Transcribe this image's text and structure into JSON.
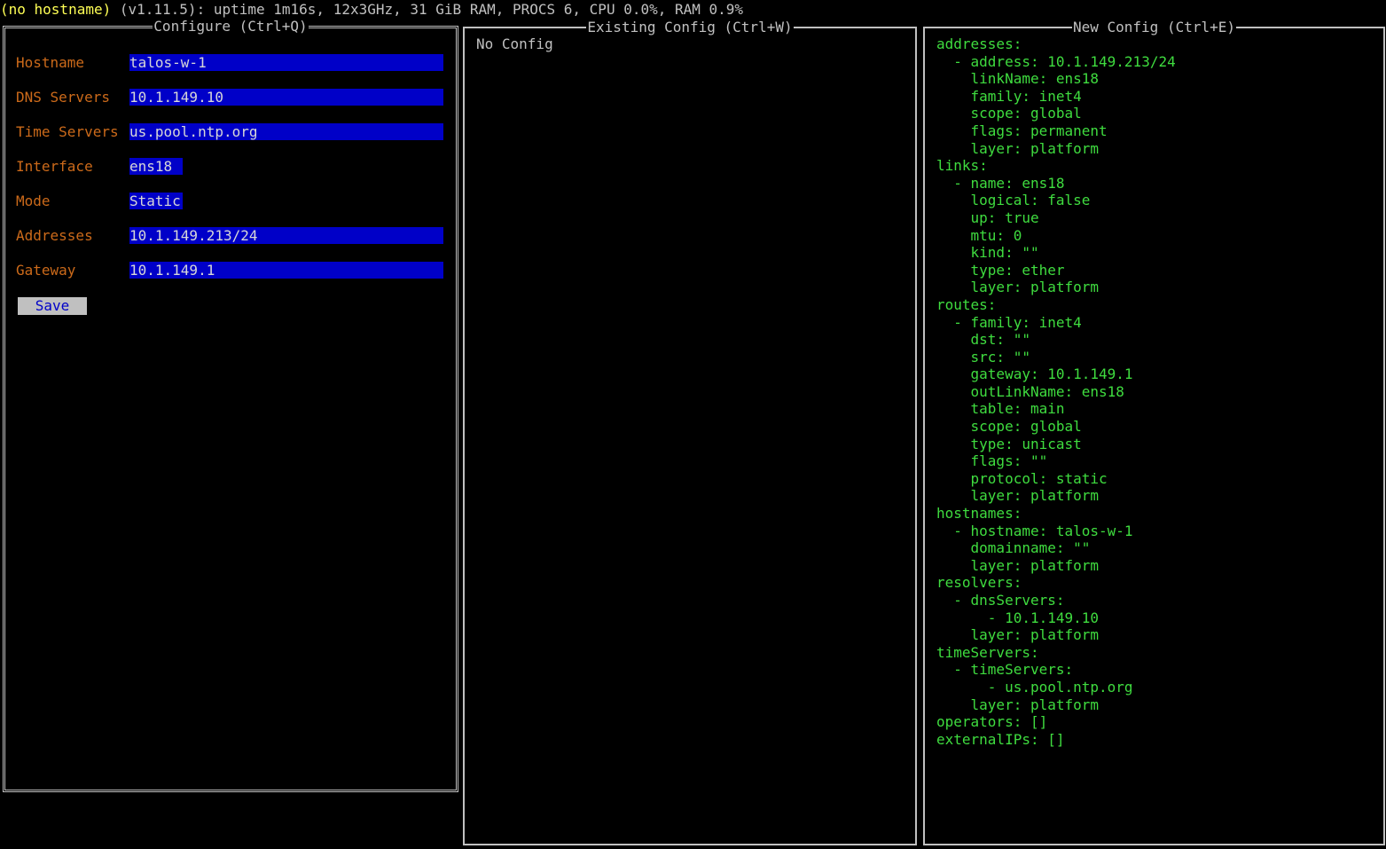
{
  "status_bar": {
    "hostname": "(no hostname)",
    "info": " (v1.11.5): uptime 1m16s, 12x3GHz, 31 GiB RAM, PROCS 6, CPU 0.0%, RAM 0.9%"
  },
  "configure": {
    "title": "Configure (Ctrl+Q)",
    "fields": {
      "hostname": {
        "label": "Hostname",
        "value": "talos-w-1"
      },
      "dns": {
        "label": "DNS Servers",
        "value": "10.1.149.10"
      },
      "time": {
        "label": "Time Servers",
        "value": "us.pool.ntp.org"
      },
      "interface": {
        "label": "Interface",
        "value": "ens18"
      },
      "mode": {
        "label": "Mode",
        "value": "Static"
      },
      "addresses": {
        "label": "Addresses",
        "value": "10.1.149.213/24"
      },
      "gateway": {
        "label": "Gateway",
        "value": "10.1.149.1"
      }
    },
    "save_label": "Save"
  },
  "existing": {
    "title": "Existing Config (Ctrl+W)",
    "body": "No Config"
  },
  "new_config": {
    "title": "New Config (Ctrl+E)",
    "lines": [
      "addresses:",
      "  - address: 10.1.149.213/24",
      "    linkName: ens18",
      "    family: inet4",
      "    scope: global",
      "    flags: permanent",
      "    layer: platform",
      "links:",
      "  - name: ens18",
      "    logical: false",
      "    up: true",
      "    mtu: 0",
      "    kind: \"\"",
      "    type: ether",
      "    layer: platform",
      "routes:",
      "  - family: inet4",
      "    dst: \"\"",
      "    src: \"\"",
      "    gateway: 10.1.149.1",
      "    outLinkName: ens18",
      "    table: main",
      "    scope: global",
      "    type: unicast",
      "    flags: \"\"",
      "    protocol: static",
      "    layer: platform",
      "hostnames:",
      "  - hostname: talos-w-1",
      "    domainname: \"\"",
      "    layer: platform",
      "resolvers:",
      "  - dnsServers:",
      "      - 10.1.149.10",
      "    layer: platform",
      "timeServers:",
      "  - timeServers:",
      "      - us.pool.ntp.org",
      "    layer: platform",
      "operators: []",
      "externalIPs: []"
    ]
  },
  "colors": {
    "background": "#000000",
    "label": "#cc6a1a",
    "input_bg": "#0000c8",
    "yaml_text": "#3fdc3f",
    "hostname_status": "#ffff55"
  }
}
